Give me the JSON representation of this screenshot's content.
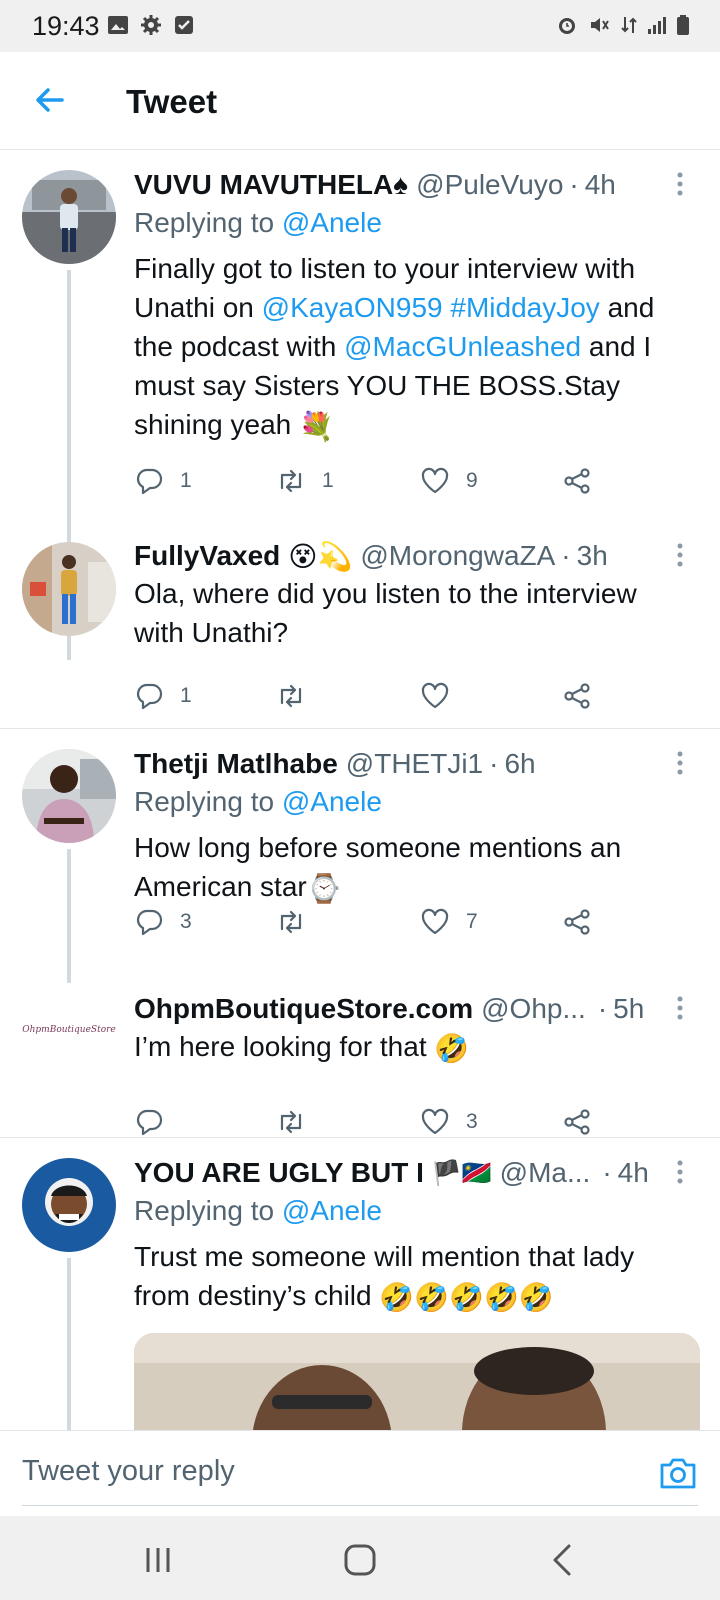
{
  "status_bar": {
    "time": "19:43",
    "left_icons": [
      "image-icon",
      "gear-icon",
      "check-box-icon"
    ],
    "right_icons": [
      "alarm-icon",
      "mute-icon",
      "data-arrows-icon",
      "signal-icon",
      "battery-icon"
    ]
  },
  "header": {
    "title": "Tweet",
    "back_icon": "arrow-left-icon"
  },
  "tweets": [
    {
      "name": "VUVU MAVUTHELA",
      "name_emoji": "♠",
      "handle": "@PuleVuyo",
      "separator": "·",
      "age": "4h",
      "replying_prefix": "Replying to",
      "replying_to": "@Anele",
      "text_parts": [
        "Finally got to listen to your interview with Unathi on ",
        "@KayaON959",
        " ",
        "#MiddayJoy",
        " and the podcast with ",
        "@MacGUnleashed",
        " and I must say Sisters YOU THE BOSS.Stay shining yeah ",
        "💐"
      ],
      "replies": "1",
      "retweets": "1",
      "likes": "9"
    },
    {
      "name": "FullyVaxed",
      "name_emoji": "😵💫",
      "handle": "@MorongwaZA",
      "separator": "·",
      "age": "3h",
      "text": "Ola, where did you listen to the interview with Unathi?",
      "replies": "1",
      "retweets": "",
      "likes": ""
    },
    {
      "name": "Thetji Matlhabe",
      "handle": "@THETJi1",
      "separator": "·",
      "age": "6h",
      "replying_prefix": "Replying to",
      "replying_to": "@Anele",
      "text": "How long before someone mentions an American star",
      "text_emoji": "⌚",
      "replies": "3",
      "retweets": "",
      "likes": "7"
    },
    {
      "name": "OhpmBoutiqueStore.com",
      "handle": "@Ohp...",
      "separator": "·",
      "age": "5h",
      "avatar_text": "OhpmBoutiqueStore",
      "text": "I’m here looking for that",
      "text_emoji": "🤣",
      "replies": "",
      "retweets": "",
      "likes": "3"
    },
    {
      "name": "YOU ARE UGLY BUT I",
      "name_emoji": "🏴🇳🇦",
      "handle": "@Ma...",
      "separator": "·",
      "age": "4h",
      "replying_prefix": "Replying to",
      "replying_to": "@Anele",
      "text": "Trust me someone will mention that lady from destiny’s child",
      "text_emoji": "🤣🤣🤣🤣🤣"
    }
  ],
  "compose": {
    "placeholder": "Tweet your reply",
    "camera_icon": "camera-icon"
  },
  "nav_bar": {
    "icons": [
      "recents-icon",
      "home-icon",
      "back-icon"
    ]
  },
  "colors": {
    "accent": "#1d9bf0",
    "secondary_text": "#536471",
    "divider": "#e2e6ea"
  }
}
